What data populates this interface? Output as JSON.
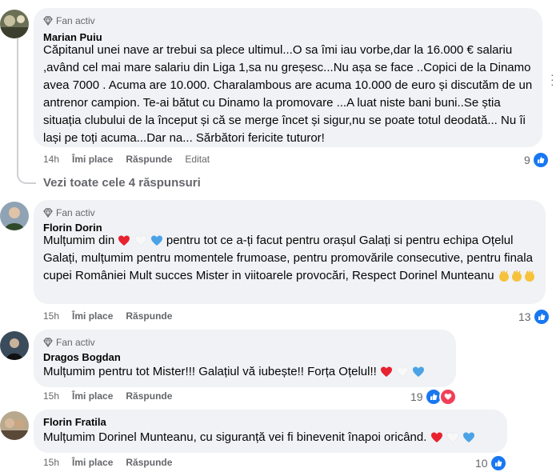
{
  "badge_label": "Fan activ",
  "comments": [
    {
      "author": "Marian Puiu",
      "text": "Căpitanul unei nave ar trebui sa plece ultimul...O sa îmi iau vorbe,dar la 16.000 € salariu ,având cel mai mare salariu din Liga 1,sa nu greșesc...Nu așa se face ..Copici de la Dinamo avea 7000 . Acuma are 10.000. Charalambous are acuma 10.000 de euro și discutăm de un antrenor campion. Te-ai bătut cu Dinamo la promovare ...A luat niste bani buni..Se știa situația clubului de la început și că se merge încet și sigur,nu se poate totul deodată... Nu îi lași pe toți acuma...Dar na... Sărbători fericite tuturor!",
      "time": "14h",
      "like": "Îmi place",
      "reply": "Răspunde",
      "edited": "Editat",
      "reactions": "9"
    },
    {
      "author": "Florin Dorin",
      "text_a": "Mulțumim din",
      "text_b": "pentru tot ce a-ți facut pentru orașul Galați si pentru echipa Oțelul Galați, mulțumim pentru momentele frumoase, pentru promovările consecutive, pentru finala cupei României Mult succes Mister in viitoarele provocări, Respect Dorinel Munteanu",
      "time": "15h",
      "like": "Îmi place",
      "reply": "Răspunde",
      "reactions": "13"
    },
    {
      "author": "Dragos Bogdan",
      "text": "Mulțumim pentru tot Mister!!! Galațiul vă iubește!! Forța Oțelul!!",
      "time": "15h",
      "like": "Îmi place",
      "reply": "Răspunde",
      "reactions": "19"
    },
    {
      "author": "Florin Fratila",
      "text": "Mulțumim Dorinel Munteanu, cu siguranță vei fi binevenit înapoi oricând.",
      "time": "15h",
      "like": "Îmi place",
      "reply": "Răspunde",
      "reactions": "10"
    }
  ],
  "view_replies": "Vezi toate cele 4 răspunsuri",
  "colors": {
    "like": "#1877f2",
    "love": "#f33e58",
    "bubble": "#f0f2f5",
    "muted": "#65676b"
  }
}
